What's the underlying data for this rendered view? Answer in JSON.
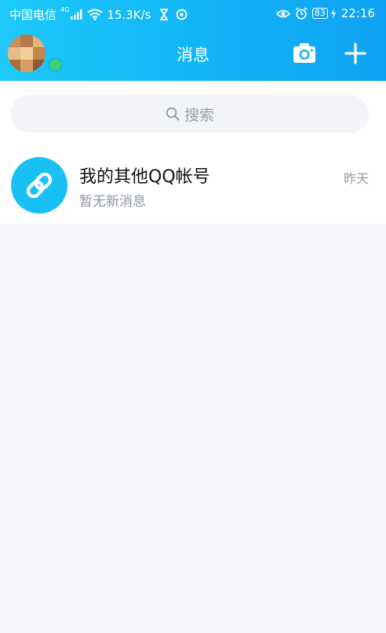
{
  "status_bar": {
    "carrier": "中国电信",
    "network_type": "4G",
    "speed": "15.3K/s",
    "battery": "83",
    "time": "22:16"
  },
  "header": {
    "title": "消息",
    "camera_icon": "camera-icon",
    "plus_icon": "plus-icon"
  },
  "search": {
    "placeholder": "搜索",
    "icon": "search-icon"
  },
  "conversations": [
    {
      "title": "我的其他QQ帐号",
      "subtitle": "暂无新消息",
      "time": "昨天",
      "icon": "link-icon"
    }
  ],
  "colors": {
    "header_start": "#1ec9fa",
    "header_end": "#0fa2f3",
    "online": "#3fd16b",
    "link_avatar": "#19c0f4",
    "background": "#f4f5f9"
  }
}
